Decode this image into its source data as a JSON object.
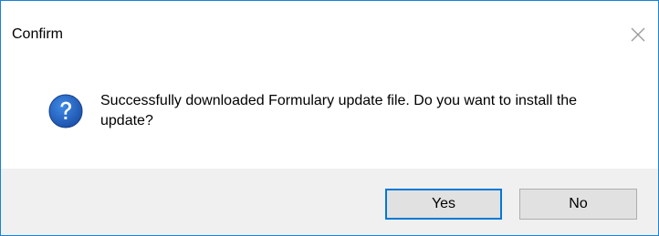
{
  "window": {
    "title": "Confirm",
    "close_icon": "close-icon"
  },
  "message": {
    "icon": "question-icon",
    "text": "Successfully downloaded Formulary update file. Do you want to install the update?"
  },
  "buttons": {
    "yes_label": "Yes",
    "no_label": "No"
  },
  "colors": {
    "window_border": "#1883d7",
    "icon_blue": "#1f5fbf",
    "footer_bg": "#f0f0f0",
    "default_button_border": "#0078d7"
  }
}
